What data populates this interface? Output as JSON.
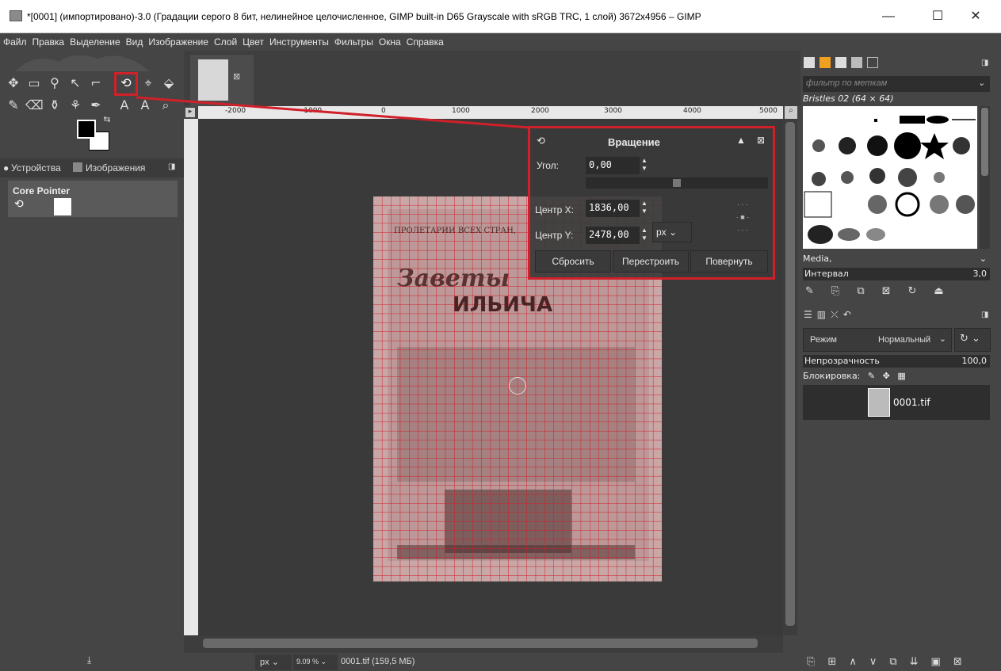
{
  "window": {
    "title": "*[0001] (импортировано)-3.0 (Градации серого 8 бит, нелинейное целочисленное, GIMP built-in D65 Grayscale with sRGB TRC, 1 слой) 3672x4956 – GIMP",
    "minimize": "—",
    "maximize": "☐",
    "close": "✕"
  },
  "menu": [
    "Файл",
    "Правка",
    "Выделение",
    "Вид",
    "Изображение",
    "Слой",
    "Цвет",
    "Инструменты",
    "Фильтры",
    "Окна",
    "Справка"
  ],
  "toolbox": {
    "tab_devices": "Устройства",
    "tab_images": "Изображения",
    "device_name": "Core Pointer",
    "accent": "#d0202a"
  },
  "rulers": {
    "top_ticks": [
      "-2000",
      "-1000",
      "0",
      "1000",
      "2000",
      "3000",
      "4000",
      "5000"
    ]
  },
  "rotate": {
    "title": "Вращение",
    "angle_label": "Угол:",
    "angle_value": "0,00",
    "cx_label": "Центр X:",
    "cx_value": "1836,00",
    "cy_label": "Центр Y:",
    "cy_value": "2478,00",
    "unit": "px",
    "reset": "Сбросить",
    "readjust": "Перестроить",
    "rotate_btn": "Повернуть"
  },
  "document": {
    "heading1": "ПРОЛЕТАРИИ ВСЕХ СТРАН,",
    "heading2": "Заветы",
    "heading3": "ИЛЬИЧА"
  },
  "status": {
    "unit": "px",
    "zoom": "9.09 %",
    "file": "0001.tif (159,5 МБ)"
  },
  "brushes": {
    "filter_placeholder": "фильтр по меткам",
    "current": "Bristles 02 (64 × 64)",
    "tag": "Media,",
    "spacing_label": "Интервал",
    "spacing_value": "3,0"
  },
  "layers": {
    "mode_label": "Режим",
    "mode_value": "Нормальный",
    "opacity_label": "Непрозрачность",
    "opacity_value": "100,0",
    "lock_label": "Блокировка:",
    "layer_name": "0001.tif"
  }
}
